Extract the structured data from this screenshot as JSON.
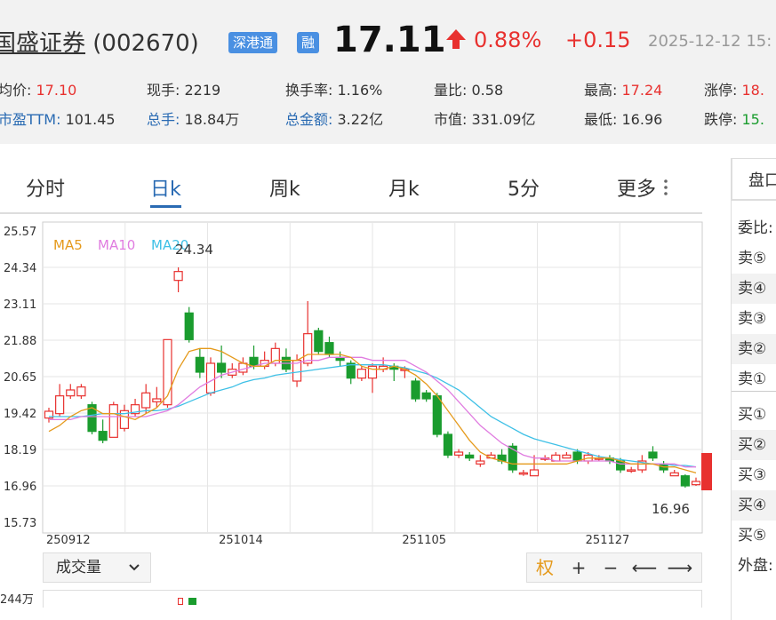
{
  "header": {
    "stock_name": "国盛证券",
    "stock_code": "(002670)",
    "badges": [
      "深港通",
      "融"
    ],
    "price": "17.11",
    "change_pct": "0.88%",
    "change_amt": "+0.15",
    "time": "2025-12-12 15:"
  },
  "stats": {
    "row1": [
      {
        "label": "均价:",
        "value": "17.10",
        "color": "red"
      },
      {
        "label": "现手:",
        "value": "2219"
      },
      {
        "label": "换手率:",
        "value": "1.16%"
      },
      {
        "label": "量比:",
        "value": "0.58"
      },
      {
        "label": "最高:",
        "value": "17.24",
        "color": "red"
      },
      {
        "label": "涨停:",
        "value": "18.",
        "color": "red"
      }
    ],
    "row2": [
      {
        "label": "市盈TTM:",
        "value": "101.45"
      },
      {
        "label": "总手:",
        "value": "18.84万"
      },
      {
        "label": "总金额:",
        "value": "3.22亿"
      },
      {
        "label": "市值:",
        "value": "331.09亿"
      },
      {
        "label": "最低:",
        "value": "16.96"
      },
      {
        "label": "跌停:",
        "value": "15.",
        "color": "green"
      }
    ]
  },
  "tabs": [
    "分时",
    "日k",
    "周k",
    "月k",
    "5分",
    "更多"
  ],
  "active_tab": "日k",
  "legend": [
    "MA5",
    "MA10",
    "MA20"
  ],
  "colors": {
    "up": "#e8312f",
    "down": "#1a9c2e",
    "ma5": "#e59a1c",
    "ma10": "#e07ce0",
    "ma20": "#3ec0e6",
    "accent": "#2a6bb3"
  },
  "chart_data": {
    "type": "candlestick",
    "y_ticks": [
      "25.57",
      "24.34",
      "23.11",
      "21.88",
      "20.65",
      "19.42",
      "18.19",
      "16.96",
      "15.73"
    ],
    "ylim": [
      15.73,
      25.57
    ],
    "x_ticks": [
      "250912",
      "251014",
      "251105",
      "251127"
    ],
    "x_tick_index": [
      0,
      16,
      33,
      50
    ],
    "high_label": "24.34",
    "low_label": "16.96",
    "candles": [
      [
        19.25,
        19.48,
        19.1,
        19.6
      ],
      [
        19.4,
        20.0,
        19.3,
        20.4
      ],
      [
        20.0,
        20.2,
        19.9,
        20.4
      ],
      [
        20.0,
        20.3,
        19.9,
        20.4
      ],
      [
        19.7,
        18.8,
        18.7,
        19.8
      ],
      [
        18.8,
        18.5,
        18.4,
        19.2
      ],
      [
        18.6,
        19.7,
        18.6,
        19.8
      ],
      [
        18.9,
        19.5,
        18.8,
        19.7
      ],
      [
        19.4,
        19.7,
        19.3,
        19.9
      ],
      [
        19.6,
        20.1,
        19.4,
        20.4
      ],
      [
        19.8,
        19.9,
        19.6,
        20.3
      ],
      [
        19.7,
        21.9,
        19.6,
        21.9
      ],
      [
        23.9,
        24.2,
        23.5,
        24.34
      ],
      [
        22.8,
        21.9,
        21.8,
        23.0
      ],
      [
        21.3,
        20.8,
        20.6,
        21.6
      ],
      [
        20.1,
        21.1,
        20.0,
        21.3
      ],
      [
        21.1,
        20.8,
        20.6,
        21.7
      ],
      [
        20.7,
        20.9,
        20.6,
        21.1
      ],
      [
        20.8,
        21.1,
        20.7,
        21.3
      ],
      [
        21.3,
        21.0,
        20.9,
        21.7
      ],
      [
        21.0,
        21.2,
        20.9,
        21.5
      ],
      [
        21.1,
        21.6,
        21.0,
        21.8
      ],
      [
        21.3,
        20.9,
        20.8,
        21.6
      ],
      [
        20.5,
        21.2,
        20.3,
        21.4
      ],
      [
        21.1,
        22.1,
        21.0,
        23.2
      ],
      [
        22.2,
        21.5,
        21.4,
        22.3
      ],
      [
        21.8,
        21.4,
        21.3,
        22.0
      ],
      [
        21.3,
        21.2,
        21.0,
        21.5
      ],
      [
        21.1,
        20.6,
        20.4,
        21.2
      ],
      [
        20.6,
        20.9,
        20.5,
        21.0
      ],
      [
        20.6,
        21.0,
        20.1,
        21.1
      ],
      [
        20.9,
        21.0,
        20.8,
        21.3
      ],
      [
        21.0,
        20.9,
        20.5,
        21.1
      ],
      [
        20.9,
        20.9,
        20.6,
        21.0
      ],
      [
        20.5,
        19.9,
        19.8,
        20.6
      ],
      [
        20.1,
        19.9,
        19.8,
        20.2
      ],
      [
        20.0,
        18.7,
        18.6,
        20.1
      ],
      [
        18.7,
        18.0,
        17.9,
        18.8
      ],
      [
        18.0,
        18.1,
        17.9,
        18.2
      ],
      [
        18.0,
        17.9,
        17.8,
        18.1
      ],
      [
        17.7,
        17.8,
        17.6,
        18.0
      ],
      [
        17.9,
        18.0,
        17.9,
        18.1
      ],
      [
        18.0,
        17.8,
        17.7,
        18.2
      ],
      [
        18.3,
        17.5,
        17.4,
        18.4
      ],
      [
        17.4,
        17.4,
        17.3,
        17.5
      ],
      [
        17.3,
        17.5,
        17.3,
        18.0
      ],
      [
        17.9,
        17.9,
        17.8,
        18.0
      ],
      [
        17.8,
        18.0,
        17.8,
        18.1
      ],
      [
        17.9,
        18.0,
        17.9,
        18.1
      ],
      [
        18.1,
        17.8,
        17.7,
        18.2
      ],
      [
        17.8,
        18.0,
        17.7,
        18.1
      ],
      [
        17.9,
        17.9,
        17.8,
        18.0
      ],
      [
        17.9,
        17.8,
        17.7,
        18.0
      ],
      [
        17.8,
        17.5,
        17.4,
        17.9
      ],
      [
        17.5,
        17.5,
        17.4,
        17.6
      ],
      [
        17.5,
        17.8,
        17.4,
        18.0
      ],
      [
        18.1,
        17.9,
        17.8,
        18.3
      ],
      [
        17.7,
        17.5,
        17.4,
        17.8
      ],
      [
        17.3,
        17.4,
        17.3,
        17.5
      ],
      [
        17.3,
        16.96,
        16.9,
        17.35
      ],
      [
        17.0,
        17.11,
        16.96,
        17.24
      ]
    ],
    "ma5": [
      18.8,
      19.0,
      19.3,
      19.5,
      19.6,
      19.4,
      19.4,
      19.3,
      19.2,
      19.4,
      19.6,
      20.0,
      20.9,
      21.5,
      21.6,
      21.6,
      21.5,
      21.3,
      21.1,
      21.0,
      21.0,
      21.2,
      21.2,
      21.2,
      21.4,
      21.4,
      21.4,
      21.4,
      21.3,
      21.0,
      20.9,
      20.9,
      21.0,
      20.9,
      20.7,
      20.4,
      20.0,
      19.5,
      19.0,
      18.5,
      18.1,
      17.9,
      17.8,
      17.7,
      17.7,
      17.7,
      17.7,
      17.7,
      17.7,
      17.8,
      17.9,
      17.9,
      17.9,
      17.8,
      17.7,
      17.7,
      17.7,
      17.6,
      17.6,
      17.5,
      17.4
    ],
    "ma10": [
      19.2,
      19.2,
      19.2,
      19.3,
      19.3,
      19.3,
      19.3,
      19.3,
      19.3,
      19.3,
      19.4,
      19.5,
      19.7,
      20.0,
      20.3,
      20.5,
      20.7,
      20.8,
      20.9,
      21.0,
      21.1,
      21.1,
      21.1,
      21.1,
      21.2,
      21.2,
      21.3,
      21.3,
      21.3,
      21.3,
      21.2,
      21.2,
      21.2,
      21.2,
      21.0,
      20.8,
      20.5,
      20.2,
      19.8,
      19.4,
      19.0,
      18.7,
      18.4,
      18.2,
      18.0,
      17.9,
      17.9,
      17.8,
      17.8,
      17.8,
      17.8,
      17.8,
      17.8,
      17.7,
      17.7,
      17.7,
      17.7,
      17.7,
      17.7,
      17.6,
      17.6
    ],
    "ma20": [
      19.3,
      19.3,
      19.3,
      19.3,
      19.35,
      19.4,
      19.4,
      19.4,
      19.45,
      19.5,
      19.5,
      19.55,
      19.65,
      19.8,
      19.95,
      20.1,
      20.2,
      20.3,
      20.45,
      20.55,
      20.6,
      20.7,
      20.75,
      20.8,
      20.85,
      20.9,
      20.95,
      21.0,
      21.05,
      21.05,
      21.05,
      21.05,
      21.0,
      20.95,
      20.85,
      20.75,
      20.6,
      20.4,
      20.2,
      19.9,
      19.6,
      19.3,
      19.1,
      18.9,
      18.7,
      18.55,
      18.45,
      18.35,
      18.25,
      18.15,
      18.05,
      17.95,
      17.9,
      17.85,
      17.8,
      17.75,
      17.7,
      17.7,
      17.65,
      17.65,
      17.6
    ]
  },
  "volume": {
    "select_label": "成交量",
    "max_label": "244万"
  },
  "controls": [
    "权",
    "+",
    "−",
    "⟵",
    "⟶"
  ],
  "side": {
    "title": "盘口",
    "rows": [
      "委比:",
      "卖⑤",
      "卖④",
      "卖③",
      "卖②",
      "卖①",
      "买①",
      "买②",
      "买③",
      "买④",
      "买⑤",
      "外盘:"
    ]
  }
}
